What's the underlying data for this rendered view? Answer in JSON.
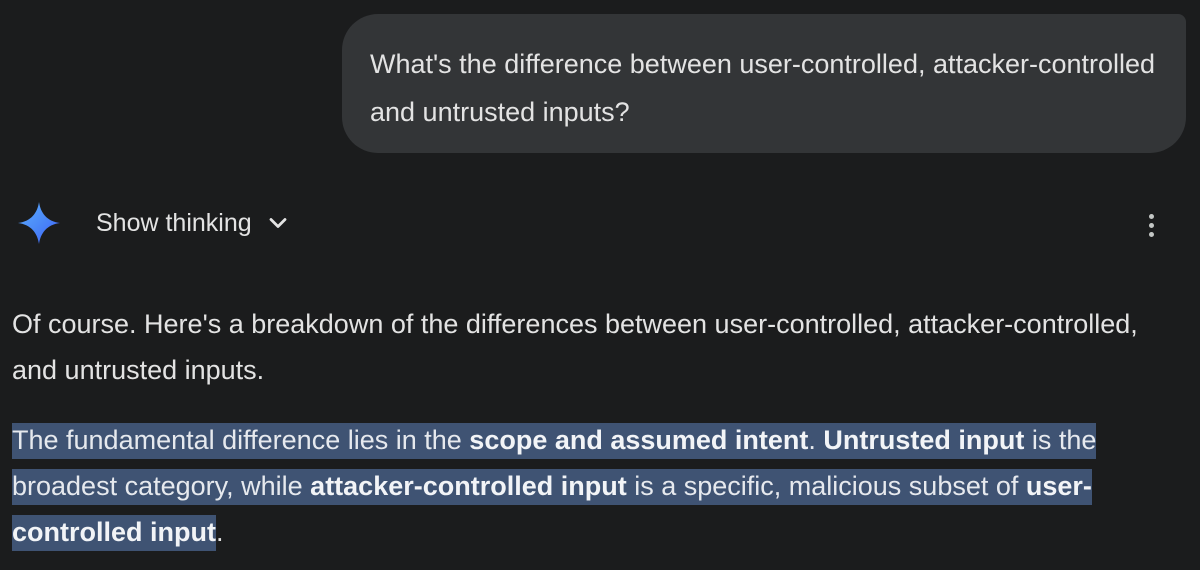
{
  "user_message": {
    "text": "What's the difference between user-controlled, attacker-controlled and untrusted inputs?"
  },
  "assistant": {
    "logo_icon": "gemini-sparkle-icon",
    "thinking_label": "Show thinking",
    "thinking_chevron_icon": "chevron-down-icon",
    "more_icon": "more-vertical-icon",
    "paragraph1": "Of course. Here's a breakdown of the differences between user-controlled, attacker-controlled, and untrusted inputs.",
    "paragraph2": {
      "part1": "The fundamental difference lies in the ",
      "bold1": "scope and assumed intent",
      "part2": ". ",
      "bold2": "Untrusted input",
      "part3": " is the broadest category, while ",
      "bold3": "attacker-controlled input",
      "part4": " is a specific, malicious subset of ",
      "bold4": "user-controlled input",
      "part5": "."
    }
  },
  "colors": {
    "background": "#1b1c1d",
    "user_bubble": "#333537",
    "selection_highlight": "#3f5373",
    "text": "#e3e3e3",
    "sparkle_gradient_start": "#4fa0ff",
    "sparkle_gradient_end": "#3d5afe"
  }
}
